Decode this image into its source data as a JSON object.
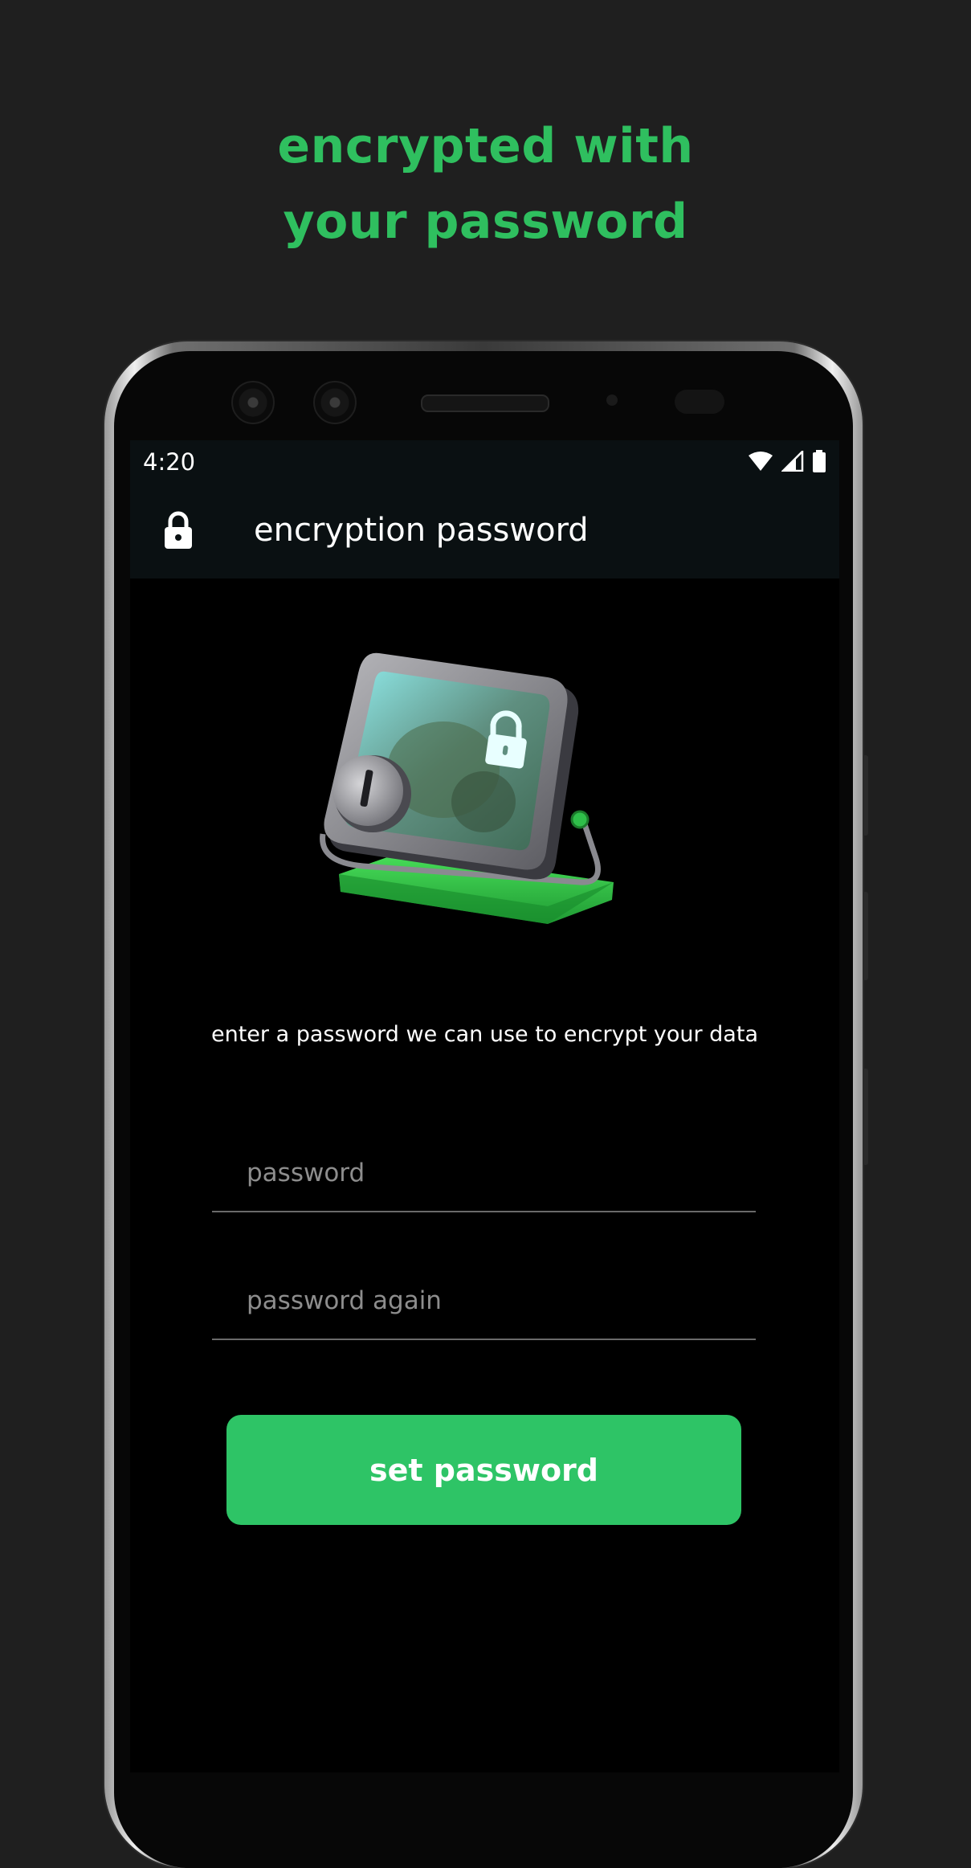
{
  "marketing": {
    "headline_line1": "encrypted with",
    "headline_line2": "your password",
    "accent_color": "#2fbf5f"
  },
  "status_bar": {
    "time": "4:20",
    "icons": [
      "wifi-icon",
      "cell-signal-icon",
      "battery-icon"
    ]
  },
  "app_bar": {
    "icon": "lock-icon",
    "title": "encryption password"
  },
  "hero": {
    "image": "encrypted-device-illustration"
  },
  "form": {
    "prompt": "enter a password we can use to encrypt your data",
    "password_placeholder": "password",
    "password_value": "",
    "confirm_placeholder": "password again",
    "confirm_value": "",
    "submit_label": "set password",
    "button_color": "#2ec466"
  }
}
